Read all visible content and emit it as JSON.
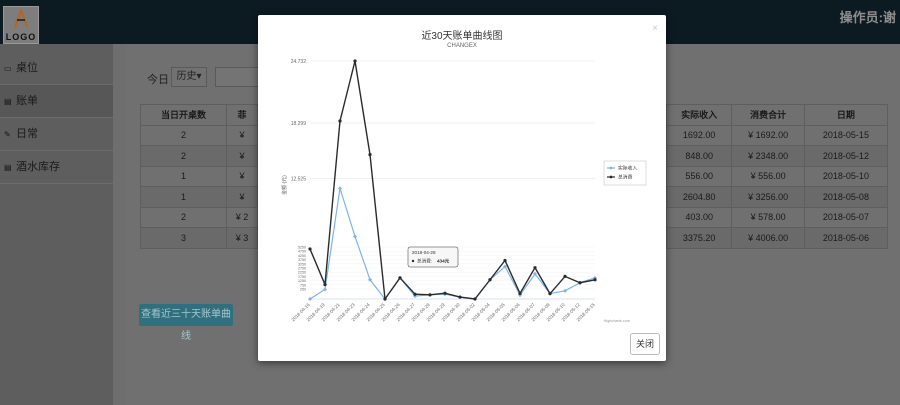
{
  "header": {
    "logo_text": "LOGO",
    "operator": "操作员:谢"
  },
  "sidebar": {
    "items": [
      {
        "label": "桌位",
        "icon": "monitor-icon"
      },
      {
        "label": "账单",
        "icon": "list-icon",
        "active": true
      },
      {
        "label": "日常",
        "icon": "edit-icon"
      },
      {
        "label": "酒水库存",
        "icon": "list-icon"
      }
    ]
  },
  "toolbar": {
    "today_label": "今日",
    "history_label": "历史▾"
  },
  "table": {
    "left_header": "当日开桌数",
    "left_header_2": "菲",
    "left_values": [
      "2",
      "2",
      "1",
      "1",
      "2",
      "3"
    ],
    "left_values_2": [
      "¥",
      "¥",
      "¥",
      "¥",
      "¥ 2",
      "¥ 3"
    ],
    "headers": [
      "实际收入",
      "消费合计",
      "日期"
    ],
    "rows": [
      [
        "1692.00",
        "¥ 1692.00",
        "2018-05-15"
      ],
      [
        "848.00",
        "¥ 2348.00",
        "2018-05-12"
      ],
      [
        "556.00",
        "¥ 556.00",
        "2018-05-10"
      ],
      [
        "2604.80",
        "¥ 3256.00",
        "2018-05-08"
      ],
      [
        "403.00",
        "¥ 578.00",
        "2018-05-07"
      ],
      [
        "3375.20",
        "¥ 4006.00",
        "2018-05-06"
      ]
    ]
  },
  "bottom_button": "查看近三十天账单曲线",
  "modal": {
    "close_label": "关闭",
    "close_x": "×"
  },
  "chart_data": {
    "type": "line",
    "title": "近30天账单曲线图",
    "subtitle": "CHANGEX",
    "ylabel": "金额 (元)",
    "credits": "Highcharts.com",
    "yticks": [
      "24.732",
      "18.299",
      "12.525",
      "5250",
      "4750",
      "4250",
      "3750",
      "3250",
      "2750",
      "2250",
      "1750",
      "1250",
      "750",
      "250"
    ],
    "ylim": [
      0,
      24732
    ],
    "categories": [
      "2018-04-16",
      "2018-04-19",
      "2018-04-21",
      "2018-04-23",
      "2018-04-24",
      "2018-04-25",
      "2018-04-26",
      "2018-04-27",
      "2018-04-28",
      "2018-04-29",
      "2018-04-30",
      "2018-05-02",
      "2018-05-04",
      "2018-05-05",
      "2018-05-06",
      "2018-05-07",
      "2018-05-08",
      "2018-05-10",
      "2018-05-12",
      "2018-05-15"
    ],
    "xlabels": [
      "2018-04-16",
      "2018-04-19",
      "2018-04-21",
      "2018-04-23",
      "2018-04-24",
      "2018-04-25",
      "2018-04-26",
      "2018-04-27",
      "2018-04-28",
      "2018-04-29",
      "2018-04-30",
      "2018-05-02",
      "2018-05-04",
      "2018-05-05",
      "2018-05-06",
      "2018-05-07",
      "2018-05-08",
      "2018-05-10",
      "2018-05-12",
      "2018-05-15"
    ],
    "series": [
      {
        "name": "实际收入",
        "color": "#7cb5ec",
        "values": [
          0,
          1000,
          11500,
          6500,
          2000,
          0,
          2200,
          300,
          434,
          500,
          200,
          0,
          2000,
          3375,
          403,
          2605,
          556,
          848,
          1692,
          2200
        ]
      },
      {
        "name": "总消费",
        "color": "#2b2b2b",
        "values": [
          5200,
          1500,
          18500,
          24732,
          15000,
          0,
          2200,
          500,
          434,
          600,
          200,
          0,
          2000,
          4006,
          578,
          3256,
          556,
          2348,
          1692,
          2000
        ]
      }
    ],
    "tooltip": {
      "date": "2018-04-28",
      "series": "总消费",
      "value": "434元"
    },
    "legend": "right"
  }
}
